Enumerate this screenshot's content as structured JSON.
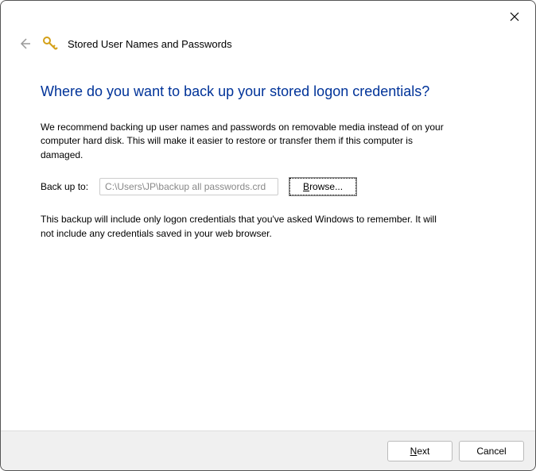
{
  "header": {
    "title": "Stored User Names and Passwords"
  },
  "content": {
    "heading": "Where do you want to back up your stored logon credentials?",
    "paragraph1": "We recommend backing up user names and passwords on removable media instead of on your computer hard disk. This will make it easier to restore or transfer them if this computer is damaged.",
    "backup_label": "Back up to:",
    "backup_path": "C:\\Users\\JP\\backup all passwords.crd",
    "browse_label": "Browse...",
    "browse_accel": "B",
    "paragraph2": "This backup will include only logon credentials that you've asked Windows to remember. It will not include any credentials saved in your web browser."
  },
  "footer": {
    "next_label": "Next",
    "next_accel": "N",
    "cancel_label": "Cancel"
  }
}
